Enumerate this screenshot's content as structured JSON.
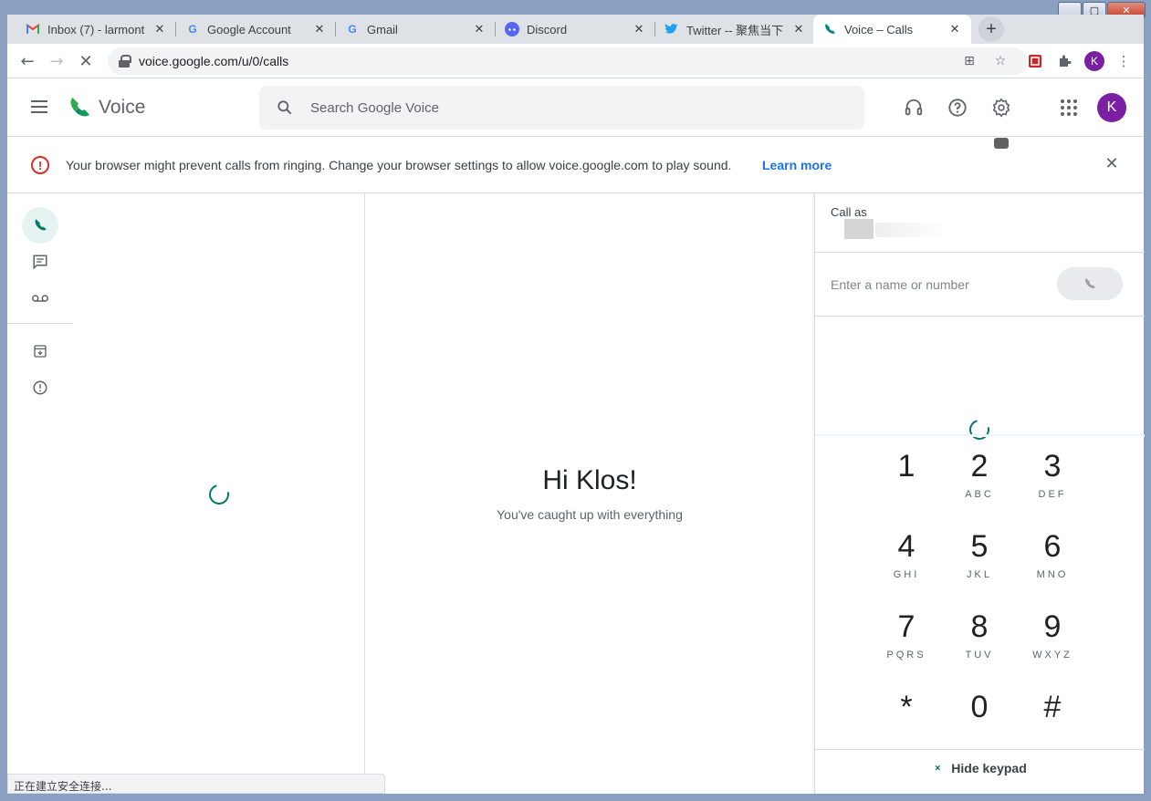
{
  "window": {
    "controls": {
      "minimize": "▁",
      "maximize": "▢",
      "close": "✕"
    }
  },
  "tabs": [
    {
      "title": "Inbox (7) - larmont",
      "icon": "gmail-icon"
    },
    {
      "title": "Google Account",
      "icon": "google-icon"
    },
    {
      "title": "Gmail",
      "icon": "google-icon"
    },
    {
      "title": "Discord",
      "icon": "discord-icon"
    },
    {
      "title": "Twitter -- 聚焦当下",
      "icon": "twitter-icon"
    },
    {
      "title": "Voice – Calls",
      "icon": "voice-icon",
      "active": true
    }
  ],
  "toolbar": {
    "url": "voice.google.com/u/0/calls",
    "avatar_letter": "K"
  },
  "app": {
    "name": "Voice",
    "search_placeholder": "Search Google Voice",
    "avatar_letter": "K"
  },
  "banner": {
    "message": "Your browser might prevent calls from ringing. Change your browser settings to allow voice.google.com to play sound.",
    "link": "Learn more"
  },
  "center": {
    "greeting": "Hi Klos!",
    "subtitle": "You've caught up with everything"
  },
  "dialer": {
    "call_as_label": "Call as",
    "input_placeholder": "Enter a name or number",
    "keys": [
      {
        "digit": "1",
        "letters": ""
      },
      {
        "digit": "2",
        "letters": "ABC"
      },
      {
        "digit": "3",
        "letters": "DEF"
      },
      {
        "digit": "4",
        "letters": "GHI"
      },
      {
        "digit": "5",
        "letters": "JKL"
      },
      {
        "digit": "6",
        "letters": "MNO"
      },
      {
        "digit": "7",
        "letters": "PQRS"
      },
      {
        "digit": "8",
        "letters": "TUV"
      },
      {
        "digit": "9",
        "letters": "WXYZ"
      },
      {
        "digit": "*",
        "letters": ""
      },
      {
        "digit": "0",
        "letters": ""
      },
      {
        "digit": "#",
        "letters": ""
      }
    ],
    "hide_keypad": "Hide keypad"
  },
  "status_bar": "正在建立安全连接..."
}
